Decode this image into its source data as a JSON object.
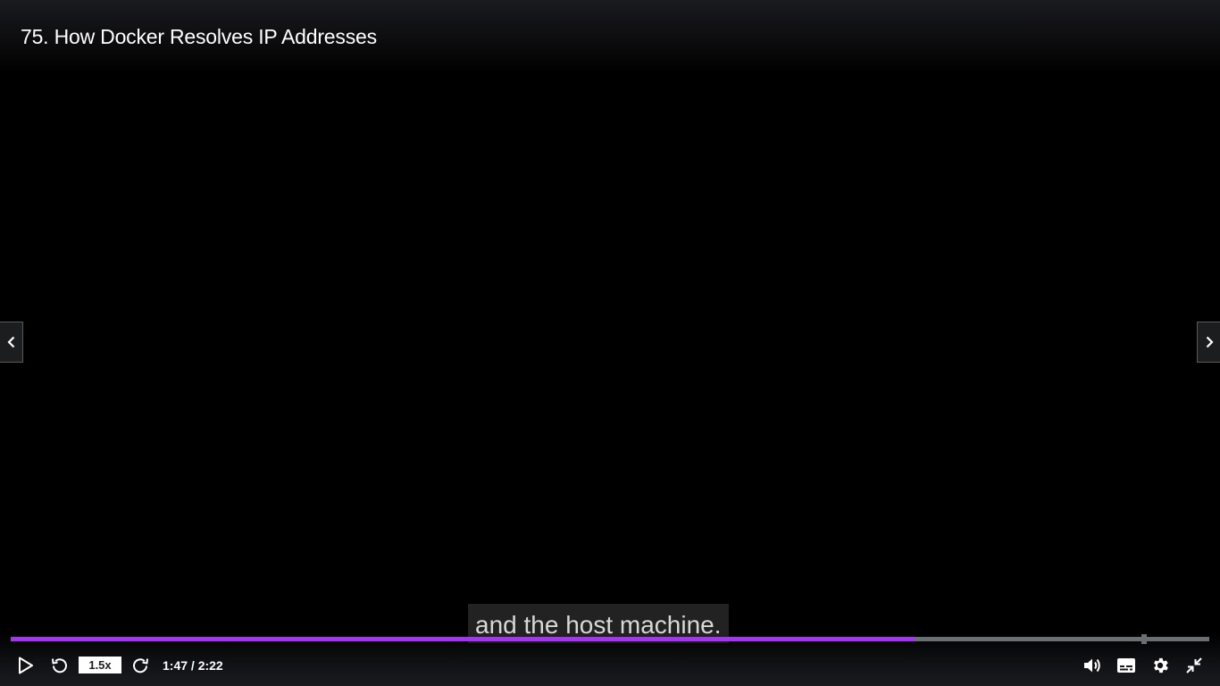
{
  "video": {
    "title": "75. How Docker Resolves IP Addresses",
    "caption": "and the host machine."
  },
  "controls": {
    "speed": "1.5x",
    "time": "1:47 / 2:22",
    "progress_fraction": 0.754
  },
  "colors": {
    "accent": "#a435f0",
    "track": "#6a6f73"
  },
  "icons": {
    "prev": "chevron-left-icon",
    "next": "chevron-right-icon",
    "play": "play-icon",
    "rewind": "rewind-5-icon",
    "forward": "forward-5-icon",
    "volume": "volume-icon",
    "captions": "captions-icon",
    "settings": "gear-icon",
    "exit_fullscreen": "exit-fullscreen-icon"
  }
}
